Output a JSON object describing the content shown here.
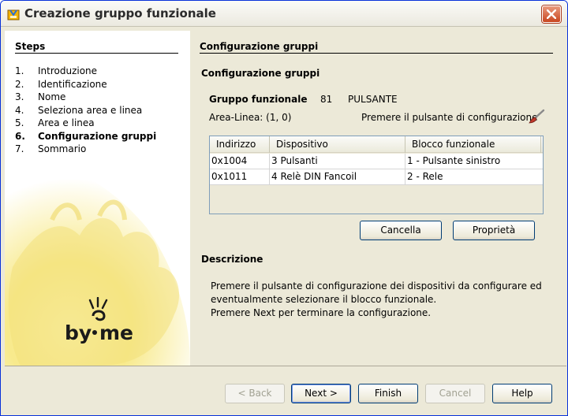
{
  "window": {
    "title": "Creazione gruppo funzionale"
  },
  "sidebar": {
    "title": "Steps",
    "steps": [
      {
        "num": "1.",
        "label": "Introduzione",
        "active": false
      },
      {
        "num": "2.",
        "label": "Identificazione",
        "active": false
      },
      {
        "num": "3.",
        "label": "Nome",
        "active": false
      },
      {
        "num": "4.",
        "label": "Seleziona area e linea",
        "active": false
      },
      {
        "num": "5.",
        "label": "Area e linea",
        "active": false
      },
      {
        "num": "6.",
        "label": "Configurazione gruppi",
        "active": true
      },
      {
        "num": "7.",
        "label": "Sommario",
        "active": false
      }
    ],
    "logo_text": "by-me"
  },
  "main": {
    "section_title": "Configurazione gruppi",
    "subtitle": "Configurazione gruppi",
    "group_label": "Gruppo funzionale",
    "group_number": "81",
    "group_name": "PULSANTE",
    "area_line": "Area-Linea: (1, 0)",
    "config_hint": "Premere il pulsante di configurazione",
    "table": {
      "columns": [
        "Indirizzo",
        "Dispositivo",
        "Blocco funzionale"
      ],
      "rows": [
        [
          "0x1004",
          "3 Pulsanti",
          "1 - Pulsante sinistro"
        ],
        [
          "0x1011",
          "4 Relè DIN Fancoil",
          "2 - Rele"
        ]
      ]
    },
    "cancel_label": "Cancella",
    "properties_label": "Proprietà",
    "description_title": "Descrizione",
    "description_lines": [
      "Premere il pulsante di configurazione dei dispositivi da configurare ed",
      "eventualmente selezionare il blocco funzionale.",
      "Premere Next per terminare la configurazione."
    ]
  },
  "footer": {
    "back_label": "< Back",
    "next_label": "Next >",
    "finish_label": "Finish",
    "cancel_label": "Cancel",
    "help_label": "Help"
  },
  "colors": {
    "accent": "#003c74",
    "close_button": "#c8461f",
    "sidebar_sun": "#f6e680"
  }
}
